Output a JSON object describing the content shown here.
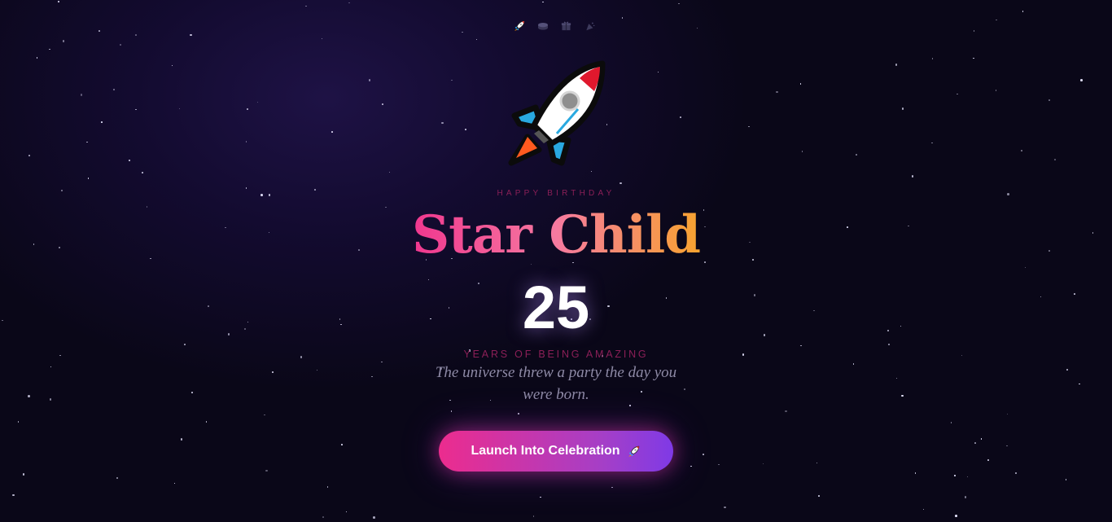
{
  "nav": {
    "items": [
      {
        "icon": "rocket-icon"
      },
      {
        "icon": "cake-icon"
      },
      {
        "icon": "gift-icon"
      },
      {
        "icon": "party-popper-icon"
      }
    ]
  },
  "hero": {
    "icon": "rocket-icon",
    "eyebrow": "HAPPY BIRTHDAY",
    "name": "Star Child",
    "age": "25",
    "age_caption": "YEARS OF BEING AMAZING",
    "tagline": "The universe threw a party the day you were born."
  },
  "cta": {
    "label": "Launch Into Celebration",
    "icon": "rocket-icon"
  },
  "colors": {
    "background": "#0a0718",
    "accent_pink": "#ec2c8e",
    "accent_purple": "#7f3ae6",
    "accent_orange": "#f7a32f",
    "caption": "#8b1f57"
  }
}
